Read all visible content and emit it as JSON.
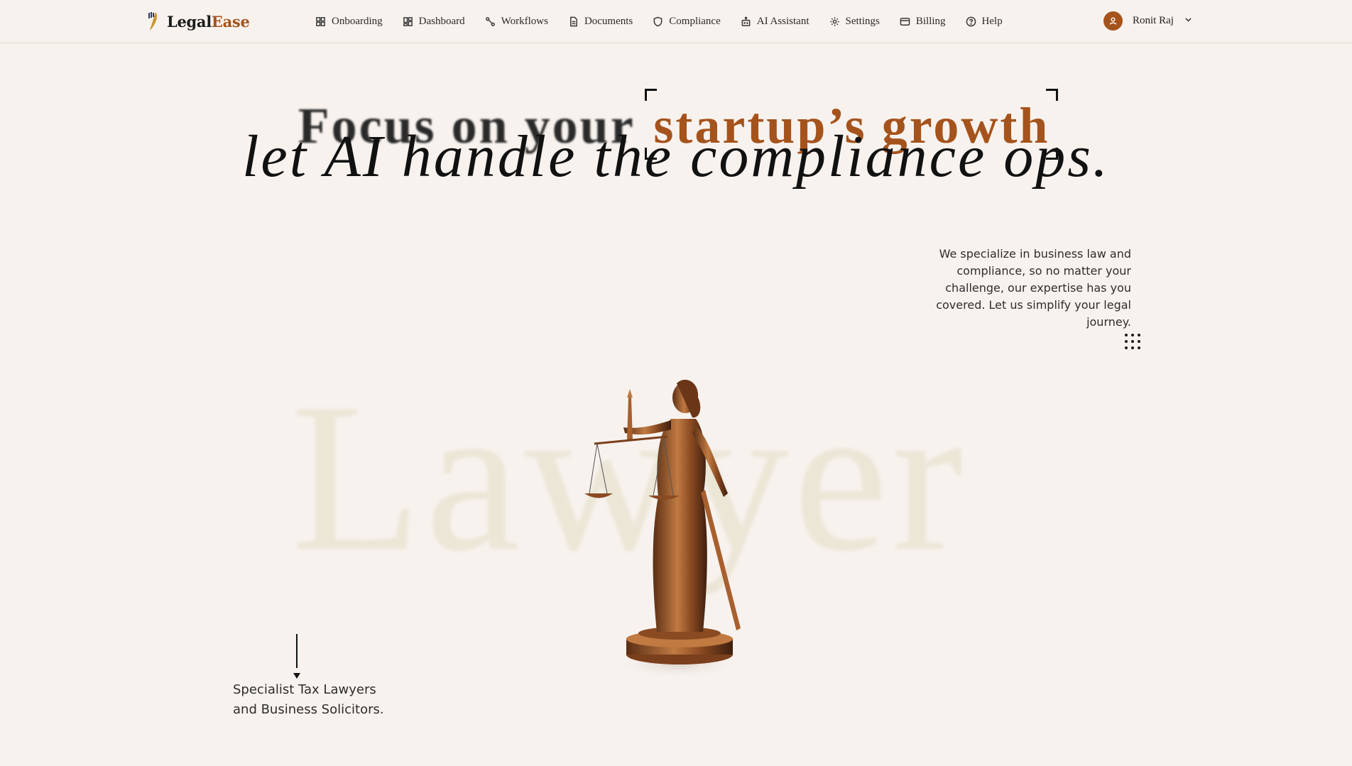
{
  "brand": {
    "name_part1": "Legal",
    "name_part2": "Ease",
    "accent_color": "#a5531c"
  },
  "nav": {
    "items": [
      {
        "label": "Onboarding",
        "icon": "grid-icon"
      },
      {
        "label": "Dashboard",
        "icon": "dashboard-icon"
      },
      {
        "label": "Workflows",
        "icon": "workflow-icon"
      },
      {
        "label": "Documents",
        "icon": "document-icon"
      },
      {
        "label": "Compliance",
        "icon": "shield-icon"
      },
      {
        "label": "AI Assistant",
        "icon": "robot-icon"
      },
      {
        "label": "Settings",
        "icon": "gear-icon"
      },
      {
        "label": "Billing",
        "icon": "credit-card-icon"
      },
      {
        "label": "Help",
        "icon": "help-circle-icon"
      }
    ]
  },
  "user": {
    "name": "Ronit Raj"
  },
  "hero": {
    "line1_plain": "Focus on your",
    "line1_accent": "startup’s growth",
    "line2": "let AI handle the compliance ops.",
    "description": "We specialize in business law and compliance, so no matter your challenge, our expertise has you covered. Let us simplify your legal journey.",
    "watermark": "Lawyer",
    "specialist_line1": "Specialist Tax Lawyers",
    "specialist_line2": "and Business Solicitors."
  }
}
